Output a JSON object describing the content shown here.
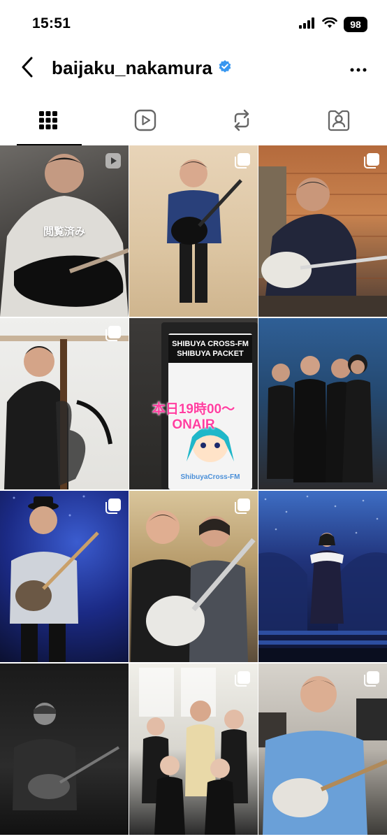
{
  "status_bar": {
    "time": "15:51",
    "battery": "98"
  },
  "header": {
    "username": "baijaku_nakamura",
    "verified_icon": "verified-badge-icon",
    "back_icon": "chevron-left-icon",
    "more_icon": "ellipsis-icon"
  },
  "tabs": [
    {
      "name": "posts",
      "icon": "grid-icon",
      "active": true
    },
    {
      "name": "reels",
      "icon": "reels-icon",
      "active": false
    },
    {
      "name": "reposts",
      "icon": "repost-icon",
      "active": false
    },
    {
      "name": "tagged",
      "icon": "tagged-person-icon",
      "active": false
    }
  ],
  "grid": {
    "tiles": [
      {
        "type": "reel",
        "seen_label": "閲覧済み"
      },
      {
        "type": "carousel"
      },
      {
        "type": "carousel"
      },
      {
        "type": "carousel"
      },
      {
        "type": "photo",
        "sign_title": "SHIBUYA CROSS-FM\nSHIBUYA PACKET",
        "sign_overlay": "本日19時00〜\nONAIR",
        "sign_footer": "ShibuyaCross-FM"
      },
      {
        "type": "photo"
      },
      {
        "type": "carousel"
      },
      {
        "type": "carousel"
      },
      {
        "type": "photo"
      },
      {
        "type": "photo"
      },
      {
        "type": "carousel"
      },
      {
        "type": "carousel"
      }
    ]
  }
}
